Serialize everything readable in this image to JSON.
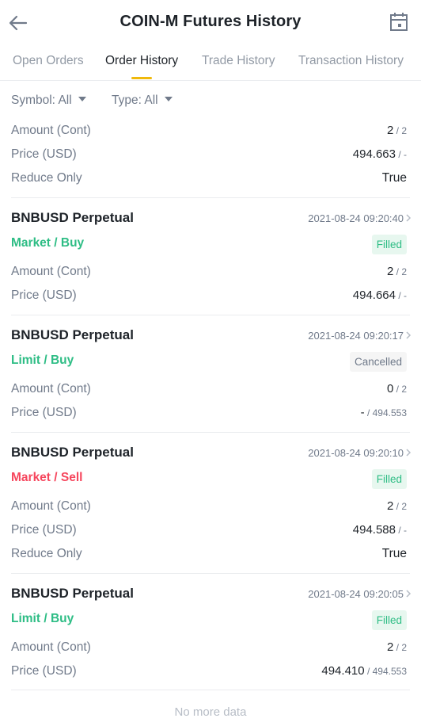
{
  "header": {
    "title": "COIN-M Futures History",
    "back_icon": "arrow-left-icon",
    "calendar_icon": "calendar-icon"
  },
  "tabs": [
    {
      "label": "Open Orders",
      "active": false
    },
    {
      "label": "Order History",
      "active": true
    },
    {
      "label": "Trade History",
      "active": false
    },
    {
      "label": "Transaction History",
      "active": false
    }
  ],
  "filters": {
    "symbol": "Symbol: All",
    "type": "Type: All"
  },
  "labels": {
    "amount": "Amount (Cont)",
    "price": "Price (USD)",
    "reduce_only": "Reduce Only"
  },
  "colors": {
    "buy": "#2ebd85",
    "sell": "#f6465d",
    "accent": "#f0b90b",
    "filled_bg": "#e7f7ef",
    "cancelled_bg": "#f5f5f5"
  },
  "partial_order": {
    "amount_main": "2",
    "amount_sub": " / 2",
    "price_main": "494.663",
    "price_sub": " / -",
    "reduce_only": "True"
  },
  "orders": [
    {
      "symbol": "BNBUSD Perpetual",
      "time": "2021-08-24 09:20:40",
      "side": "Market / Buy",
      "side_color": "buy",
      "status": "Filled",
      "amount_main": "2",
      "amount_sub": " / 2",
      "price_main": "494.664",
      "price_sub": " / -"
    },
    {
      "symbol": "BNBUSD Perpetual",
      "time": "2021-08-24 09:20:17",
      "side": "Limit / Buy",
      "side_color": "buy",
      "status": "Cancelled",
      "amount_main": "0",
      "amount_sub": " / 2",
      "price_main": "-",
      "price_sub": " / 494.553"
    },
    {
      "symbol": "BNBUSD Perpetual",
      "time": "2021-08-24 09:20:10",
      "side": "Market / Sell",
      "side_color": "sell",
      "status": "Filled",
      "amount_main": "2",
      "amount_sub": " / 2",
      "price_main": "494.588",
      "price_sub": " / -",
      "reduce_only": "True"
    },
    {
      "symbol": "BNBUSD Perpetual",
      "time": "2021-08-24 09:20:05",
      "side": "Limit / Buy",
      "side_color": "buy",
      "status": "Filled",
      "amount_main": "2",
      "amount_sub": " / 2",
      "price_main": "494.410",
      "price_sub": " / 494.553"
    }
  ],
  "footer": {
    "no_more": "No more data"
  }
}
